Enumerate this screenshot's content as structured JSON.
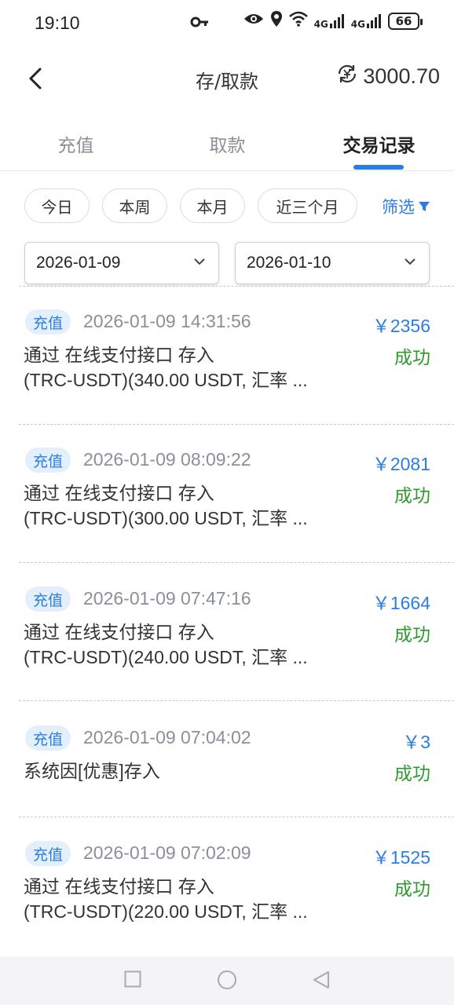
{
  "status_bar": {
    "time": "19:10",
    "signal_1": "4G",
    "signal_2": "4G",
    "battery": "66"
  },
  "header": {
    "title": "存/取款",
    "balance": "3000.70"
  },
  "tabs": [
    {
      "label": "充值",
      "active": false
    },
    {
      "label": "取款",
      "active": false
    },
    {
      "label": "交易记录",
      "active": true
    }
  ],
  "filters": {
    "chips": [
      "今日",
      "本周",
      "本月",
      "近三个月"
    ],
    "filter_label": "筛选"
  },
  "date_range": {
    "start": "2026-01-09",
    "end": "2026-01-10"
  },
  "records": [
    {
      "tag": "充值",
      "time": "2026-01-09 14:31:56",
      "amount": "￥2356",
      "desc_line1": "通过 在线支付接口 存入",
      "desc_line2": "(TRC-USDT)(340.00 USDT, 汇率 ...",
      "status": "成功"
    },
    {
      "tag": "充值",
      "time": "2026-01-09 08:09:22",
      "amount": "￥2081",
      "desc_line1": "通过 在线支付接口 存入",
      "desc_line2": "(TRC-USDT)(300.00 USDT, 汇率 ...",
      "status": "成功"
    },
    {
      "tag": "充值",
      "time": "2026-01-09 07:47:16",
      "amount": "￥1664",
      "desc_line1": "通过 在线支付接口 存入",
      "desc_line2": "(TRC-USDT)(240.00 USDT, 汇率 ...",
      "status": "成功"
    },
    {
      "tag": "充值",
      "time": "2026-01-09 07:04:02",
      "amount": "￥3",
      "desc_line1": "系统因[优惠]存入",
      "desc_line2": "",
      "status": "成功"
    },
    {
      "tag": "充值",
      "time": "2026-01-09 07:02:09",
      "amount": "￥1525",
      "desc_line1": "通过 在线支付接口 存入",
      "desc_line2": "(TRC-USDT)(220.00 USDT, 汇率 ...",
      "status": "成功"
    }
  ],
  "colors": {
    "accent": "#2a7de1",
    "success": "#2e9a2e",
    "tag_bg": "#e4effc",
    "muted": "#8a8f99"
  },
  "icons": {
    "status": [
      "key-icon",
      "eye-icon",
      "location-icon",
      "wifi-icon",
      "signal-icon",
      "battery-icon"
    ],
    "header": [
      "back-arrow-icon",
      "refresh-balance-icon"
    ],
    "filter": "funnel-icon",
    "dates": "chevron-down-icon",
    "nav": [
      "recents-square-icon",
      "home-circle-icon",
      "back-triangle-icon"
    ]
  }
}
